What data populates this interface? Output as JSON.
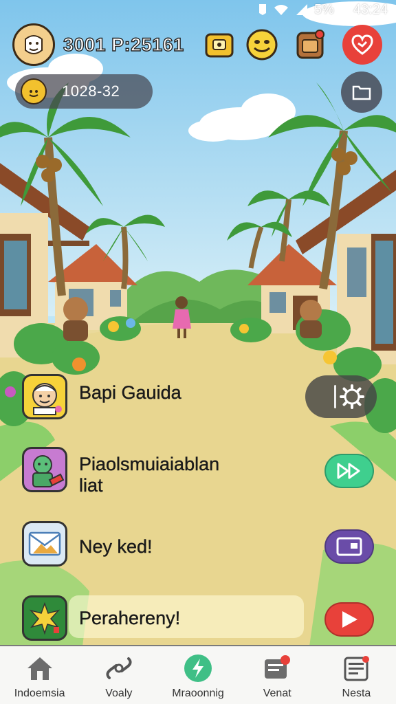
{
  "status_bar": {
    "battery_percent": "5%",
    "time": "43:24"
  },
  "hud": {
    "score": "3001 P:25161",
    "sub_value": "1028-32"
  },
  "list": [
    {
      "label": "Bapi Gauida",
      "icon": "grandpa-face-icon",
      "action_icon": "gear-icon"
    },
    {
      "label": "Piaolsmuiaiablan\nliat",
      "icon": "zombie-card-icon",
      "action_icon": "fast-forward-icon",
      "action_color": "#3fcf8e"
    },
    {
      "label": "Ney ked!",
      "icon": "envelope-icon",
      "action_icon": "card-icon",
      "action_color": "#6a4ca8"
    },
    {
      "label": "Perahereny!",
      "icon": "star-burst-icon",
      "action_icon": "play-icon",
      "action_color": "#e8413a"
    }
  ],
  "nav": [
    {
      "label": "Indoemsia",
      "icon": "home-icon"
    },
    {
      "label": "Voaly",
      "icon": "link-icon"
    },
    {
      "label": "Mraoonnig",
      "icon": "lightning-icon"
    },
    {
      "label": "Venat",
      "icon": "message-icon"
    },
    {
      "label": "Nesta",
      "icon": "news-icon"
    }
  ],
  "colors": {
    "play": "#e8413a",
    "forward": "#3fcf8e",
    "card": "#6a4ca8",
    "ground": "#ead99a",
    "sky": "#a7dbf3"
  }
}
